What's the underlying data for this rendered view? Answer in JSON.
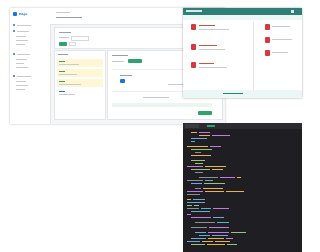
{
  "main_app": {
    "brand": "Edge",
    "page_title": "",
    "sidebar_items": [
      "",
      "",
      "",
      "",
      "",
      "",
      "",
      "",
      "",
      "",
      "",
      "",
      ""
    ],
    "buttons": {
      "primary": "",
      "secondary": ""
    }
  },
  "second_app": {
    "header_title": "",
    "rows": [
      "",
      "",
      "",
      ""
    ]
  },
  "editor": {
    "tabs": [
      "",
      "",
      ""
    ]
  },
  "colors": {
    "accent_blue": "#1a73e8",
    "accent_green": "#2fa36b",
    "teal_header": "#2f7f77",
    "red_icon": "#d9393d",
    "editor_bg": "#1f1f23"
  }
}
